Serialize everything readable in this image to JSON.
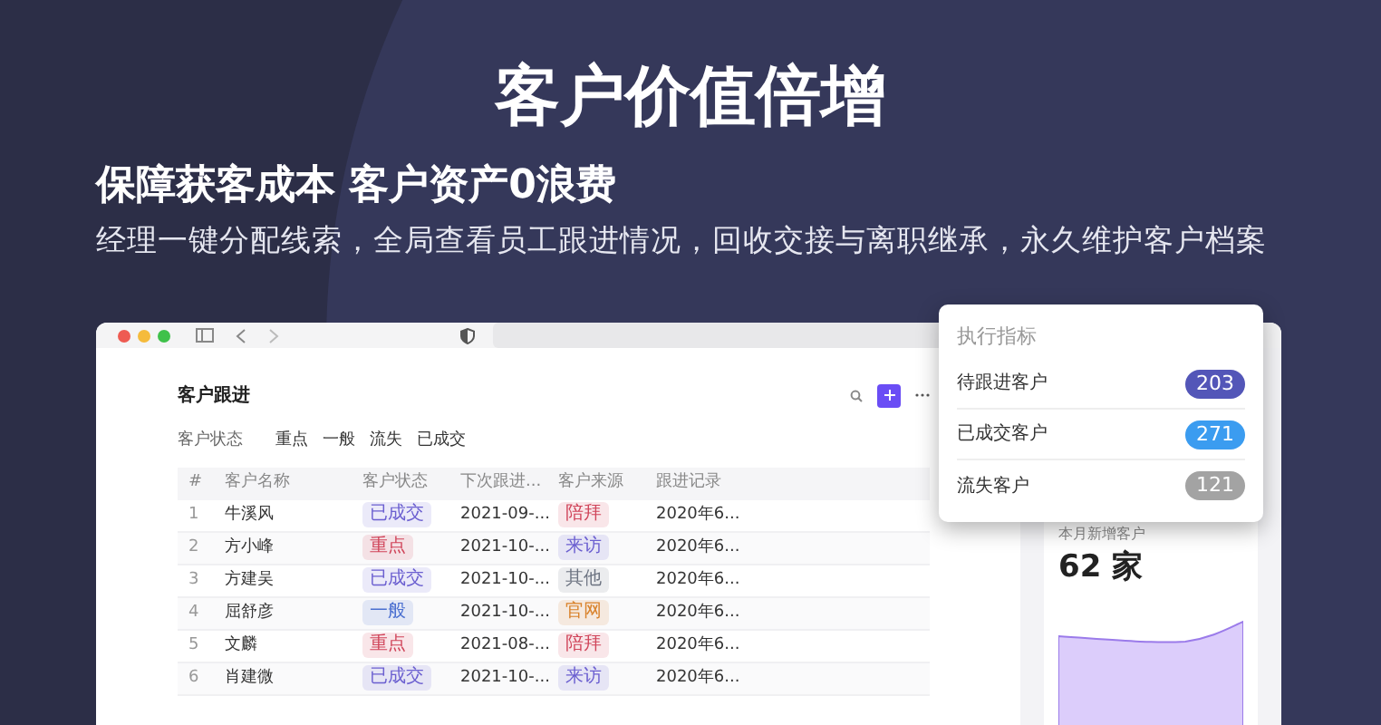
{
  "headline": "客户价值倍增",
  "subtitle": "保障获客成本 客户资产0浪费",
  "description": "经理一键分配线索，全局查看员工跟进情况，回收交接与离职继承，永久维护客户档案",
  "page": {
    "title": "客户跟进",
    "filter": {
      "label": "客户状态",
      "options": [
        "重点",
        "一般",
        "流失",
        "已成交"
      ]
    },
    "table": {
      "columns": [
        "#",
        "客户名称",
        "客户状态",
        "下次跟进...",
        "客户来源",
        "跟进记录"
      ],
      "rows": [
        {
          "index": "1",
          "name": "牛溪风",
          "status": {
            "text": "已成交",
            "color": "#6b5fd0"
          },
          "next": "2021-09-...",
          "source": {
            "text": "陪拜",
            "color": "#d0455a"
          },
          "record": "2020年6..."
        },
        {
          "index": "2",
          "name": "方小峰",
          "status": {
            "text": "重点",
            "color": "#d0455a"
          },
          "next": "2021-10-...",
          "source": {
            "text": "来访",
            "color": "#6b5fd0"
          },
          "record": "2020年6..."
        },
        {
          "index": "3",
          "name": "方建吴",
          "status": {
            "text": "已成交",
            "color": "#6b5fd0"
          },
          "next": "2021-10-...",
          "source": {
            "text": "其他",
            "color": "#6b7280"
          },
          "record": "2020年6..."
        },
        {
          "index": "4",
          "name": "屈舒彦",
          "status": {
            "text": "一般",
            "color": "#4a6fd0"
          },
          "next": "2021-10-...",
          "source": {
            "text": "官网",
            "color": "#d9822b"
          },
          "record": "2020年6..."
        },
        {
          "index": "5",
          "name": "文麟",
          "status": {
            "text": "重点",
            "color": "#d0455a"
          },
          "next": "2021-08-...",
          "source": {
            "text": "陪拜",
            "color": "#d0455a"
          },
          "record": "2020年6..."
        },
        {
          "index": "6",
          "name": "肖建微",
          "status": {
            "text": "已成交",
            "color": "#6b5fd0"
          },
          "next": "2021-10-...",
          "source": {
            "text": "来访",
            "color": "#6b5fd0"
          },
          "record": "2020年6..."
        }
      ]
    },
    "stat_card": {
      "label": "本月新增客户",
      "value": "62 家"
    }
  },
  "metrics": {
    "title": "执行指标",
    "items": [
      {
        "label": "待跟进客户",
        "count": "203",
        "color": "#5356b8"
      },
      {
        "label": "已成交客户",
        "count": "271",
        "color": "#3b9cf0"
      },
      {
        "label": "流失客户",
        "count": "121",
        "color": "#a3a3a3"
      }
    ]
  }
}
